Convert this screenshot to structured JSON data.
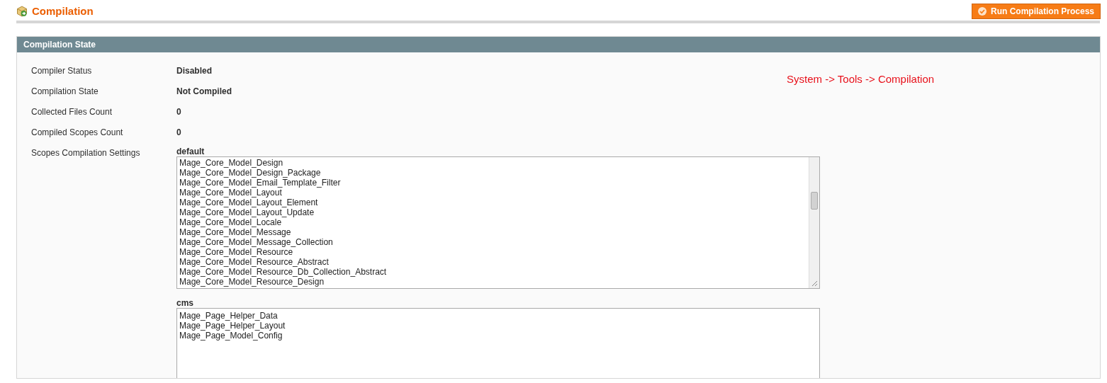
{
  "page": {
    "title": "Compilation",
    "action_button": "Run Compilation Process"
  },
  "section": {
    "title": "Compilation State",
    "fields": [
      {
        "label": "Compiler Status",
        "value": "Disabled"
      },
      {
        "label": "Compilation State",
        "value": "Not Compiled"
      },
      {
        "label": "Collected Files Count",
        "value": "0"
      },
      {
        "label": "Compiled Scopes Count",
        "value": "0"
      }
    ],
    "scopes_label": "Scopes Compilation Settings",
    "scopes": [
      {
        "name": "default",
        "scrollable": true,
        "lines": [
          "Mage_Core_Model_Design",
          "Mage_Core_Model_Design_Package",
          "Mage_Core_Model_Email_Template_Filter",
          "Mage_Core_Model_Layout",
          "Mage_Core_Model_Layout_Element",
          "Mage_Core_Model_Layout_Update",
          "Mage_Core_Model_Locale",
          "Mage_Core_Model_Message",
          "Mage_Core_Model_Message_Collection",
          "Mage_Core_Model_Resource",
          "Mage_Core_Model_Resource_Abstract",
          "Mage_Core_Model_Resource_Db_Collection_Abstract",
          "Mage_Core_Model_Resource_Design"
        ]
      },
      {
        "name": "cms",
        "scrollable": false,
        "lines": [
          "Mage_Page_Helper_Data",
          "Mage_Page_Helper_Layout",
          "Mage_Page_Model_Config"
        ]
      }
    ]
  },
  "annotation": "System -> Tools -> Compilation"
}
